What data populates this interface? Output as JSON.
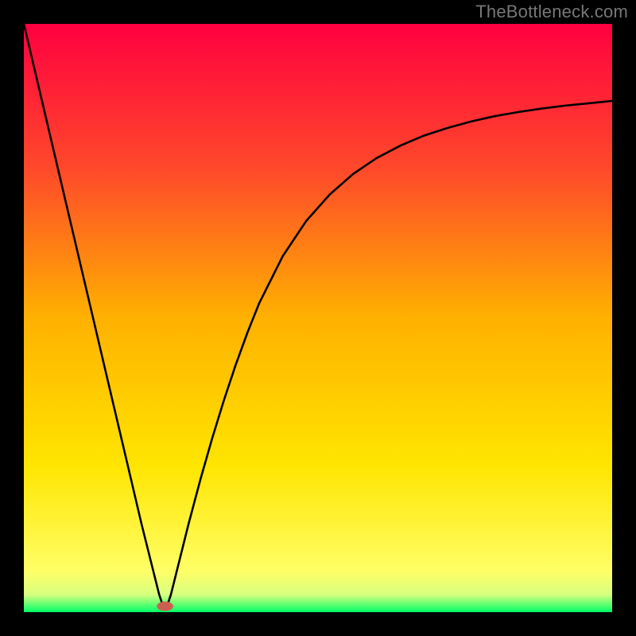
{
  "watermark": "TheBottleneck.com",
  "chart_data": {
    "type": "line",
    "title": "",
    "xlabel": "",
    "ylabel": "",
    "xlim": [
      0,
      100
    ],
    "ylim": [
      0,
      100
    ],
    "x_ticks": [],
    "y_ticks": [],
    "grid": false,
    "legend": false,
    "background_gradient": {
      "orientation": "vertical",
      "stops": [
        {
          "offset": 0.0,
          "color": "#ff0040"
        },
        {
          "offset": 0.25,
          "color": "#ff4a2a"
        },
        {
          "offset": 0.5,
          "color": "#ffb100"
        },
        {
          "offset": 0.75,
          "color": "#ffe500"
        },
        {
          "offset": 0.93,
          "color": "#ffff66"
        },
        {
          "offset": 0.97,
          "color": "#d8ff80"
        },
        {
          "offset": 1.0,
          "color": "#00ff66"
        }
      ]
    },
    "series": [
      {
        "name": "bottleneck-curve",
        "color": "#000000",
        "x": [
          0,
          2,
          4,
          6,
          8,
          10,
          12,
          14,
          16,
          18,
          20,
          22,
          23,
          23.5,
          24,
          24.5,
          25,
          26,
          28,
          30,
          32,
          34,
          36,
          38,
          40,
          44,
          48,
          52,
          56,
          60,
          64,
          68,
          72,
          76,
          80,
          84,
          88,
          92,
          96,
          100
        ],
        "y": [
          100,
          91.5,
          83,
          74.5,
          66,
          57.5,
          49,
          40.5,
          32,
          23.5,
          15,
          7,
          3,
          1.5,
          1,
          1.5,
          3,
          7,
          15,
          22.5,
          29.5,
          36,
          42,
          47.5,
          52.5,
          60.5,
          66.5,
          71,
          74.5,
          77.2,
          79.3,
          81,
          82.3,
          83.4,
          84.3,
          85,
          85.6,
          86.1,
          86.5,
          86.9
        ]
      }
    ],
    "marker": {
      "name": "optimal-point",
      "x": 24,
      "y": 1,
      "rx": 1.4,
      "ry": 0.8,
      "fill": "#cc6050"
    }
  }
}
